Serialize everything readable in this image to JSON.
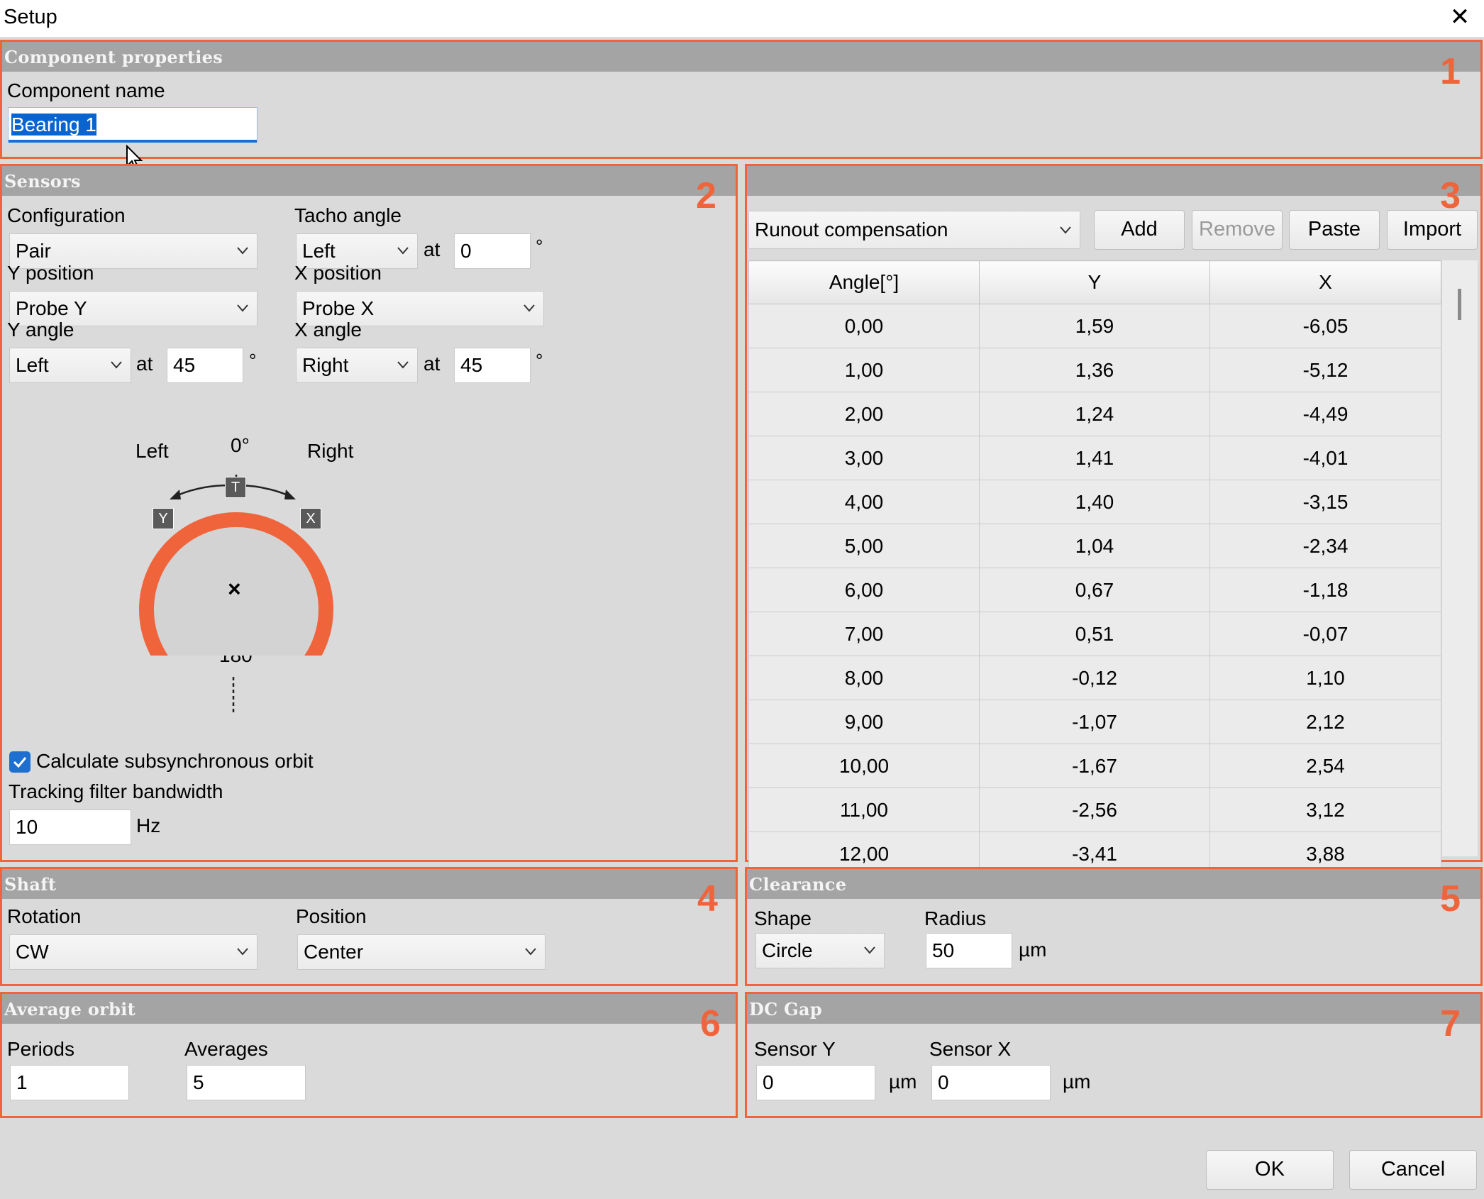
{
  "window": {
    "title": "Setup",
    "close_glyph": "✕"
  },
  "panel_numbers": [
    "1",
    "2",
    "3",
    "4",
    "5",
    "6",
    "7"
  ],
  "component": {
    "header": "Component properties",
    "name_label": "Component name",
    "name_value": "Bearing 1"
  },
  "sensors": {
    "header": "Sensors",
    "configuration_label": "Configuration",
    "configuration_value": "Pair",
    "tacho_label": "Tacho angle",
    "tacho_dir": "Left",
    "tacho_at": "at",
    "tacho_value": "0",
    "y_position_label": "Y position",
    "y_position_value": "Probe Y",
    "x_position_label": "X position",
    "x_position_value": "Probe X",
    "y_angle_label": "Y angle",
    "y_angle_dir": "Left",
    "y_at": "at",
    "y_angle_value": "45",
    "x_angle_label": "X angle",
    "x_angle_dir": "Right",
    "x_at": "at",
    "x_angle_value": "45",
    "degree_symbol": "°",
    "diagram": {
      "left_label": "Left",
      "right_label": "Right",
      "top_label": "0°",
      "bottom_label": "180°",
      "t_marker": "T",
      "y_marker": "Y",
      "x_marker": "X",
      "center_mark": "×",
      "ring_color": "#f0643c",
      "disc_color": "#d3d3d3"
    },
    "subsync_label": "Calculate subsynchronous orbit",
    "subsync_checked": true,
    "tracking_label": "Tracking filter bandwidth",
    "tracking_value": "10",
    "tracking_unit": "Hz"
  },
  "runout": {
    "mode_value": "Runout compensation",
    "buttons": {
      "add": "Add",
      "remove": "Remove",
      "paste": "Paste",
      "import": "Import"
    },
    "columns": [
      "Angle[°]",
      "Y",
      "X"
    ],
    "rows": [
      [
        "0,00",
        "1,59",
        "-6,05"
      ],
      [
        "1,00",
        "1,36",
        "-5,12"
      ],
      [
        "2,00",
        "1,24",
        "-4,49"
      ],
      [
        "3,00",
        "1,41",
        "-4,01"
      ],
      [
        "4,00",
        "1,40",
        "-3,15"
      ],
      [
        "5,00",
        "1,04",
        "-2,34"
      ],
      [
        "6,00",
        "0,67",
        "-1,18"
      ],
      [
        "7,00",
        "0,51",
        "-0,07"
      ],
      [
        "8,00",
        "-0,12",
        "1,10"
      ],
      [
        "9,00",
        "-1,07",
        "2,12"
      ],
      [
        "10,00",
        "-1,67",
        "2,54"
      ],
      [
        "11,00",
        "-2,56",
        "3,12"
      ],
      [
        "12,00",
        "-3,41",
        "3,88"
      ]
    ]
  },
  "shaft": {
    "header": "Shaft",
    "rotation_label": "Rotation",
    "rotation_value": "CW",
    "position_label": "Position",
    "position_value": "Center"
  },
  "clearance": {
    "header": "Clearance",
    "shape_label": "Shape",
    "shape_value": "Circle",
    "radius_label": "Radius",
    "radius_value": "50",
    "radius_unit": "µm"
  },
  "average_orbit": {
    "header": "Average orbit",
    "periods_label": "Periods",
    "periods_value": "1",
    "averages_label": "Averages",
    "averages_value": "5"
  },
  "dc_gap": {
    "header": "DC Gap",
    "sensor_y_label": "Sensor Y",
    "sensor_y_value": "0",
    "sensor_y_unit": "µm",
    "sensor_x_label": "Sensor X",
    "sensor_x_value": "0",
    "sensor_x_unit": "µm"
  },
  "footer": {
    "ok": "OK",
    "cancel": "Cancel"
  },
  "colors": {
    "accent": "#f0643c",
    "selection": "#0a64d0",
    "header_bar": "#a4a4a4"
  }
}
